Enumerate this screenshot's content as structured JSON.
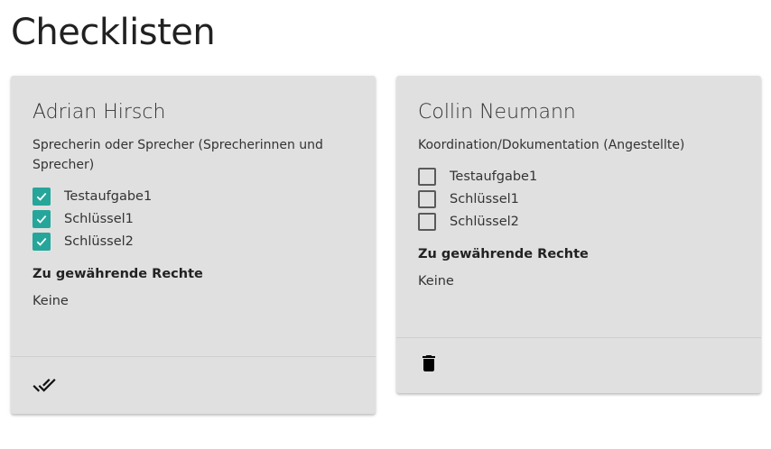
{
  "page": {
    "title": "Checklisten"
  },
  "cards": [
    {
      "name": "Adrian Hirsch",
      "role": "Sprecherin oder Sprecher (Sprecherinnen und Sprecher)",
      "tasks": [
        {
          "label": "Testaufgabe1",
          "checked": true
        },
        {
          "label": "Schlüssel1",
          "checked": true
        },
        {
          "label": "Schlüssel2",
          "checked": true
        }
      ],
      "rights_title": "Zu gewährende Rechte",
      "rights_value": "Keine",
      "action_icon": "done-all-icon"
    },
    {
      "name": "Collin Neumann",
      "role": "Koordination/Dokumentation (Angestellte)",
      "tasks": [
        {
          "label": "Testaufgabe1",
          "checked": false
        },
        {
          "label": "Schlüssel1",
          "checked": false
        },
        {
          "label": "Schlüssel2",
          "checked": false
        }
      ],
      "rights_title": "Zu gewährende Rechte",
      "rights_value": "Keine",
      "action_icon": "delete-icon"
    }
  ],
  "colors": {
    "card_background": "#e0e0e0",
    "checkbox_checked": "#26a69a"
  }
}
